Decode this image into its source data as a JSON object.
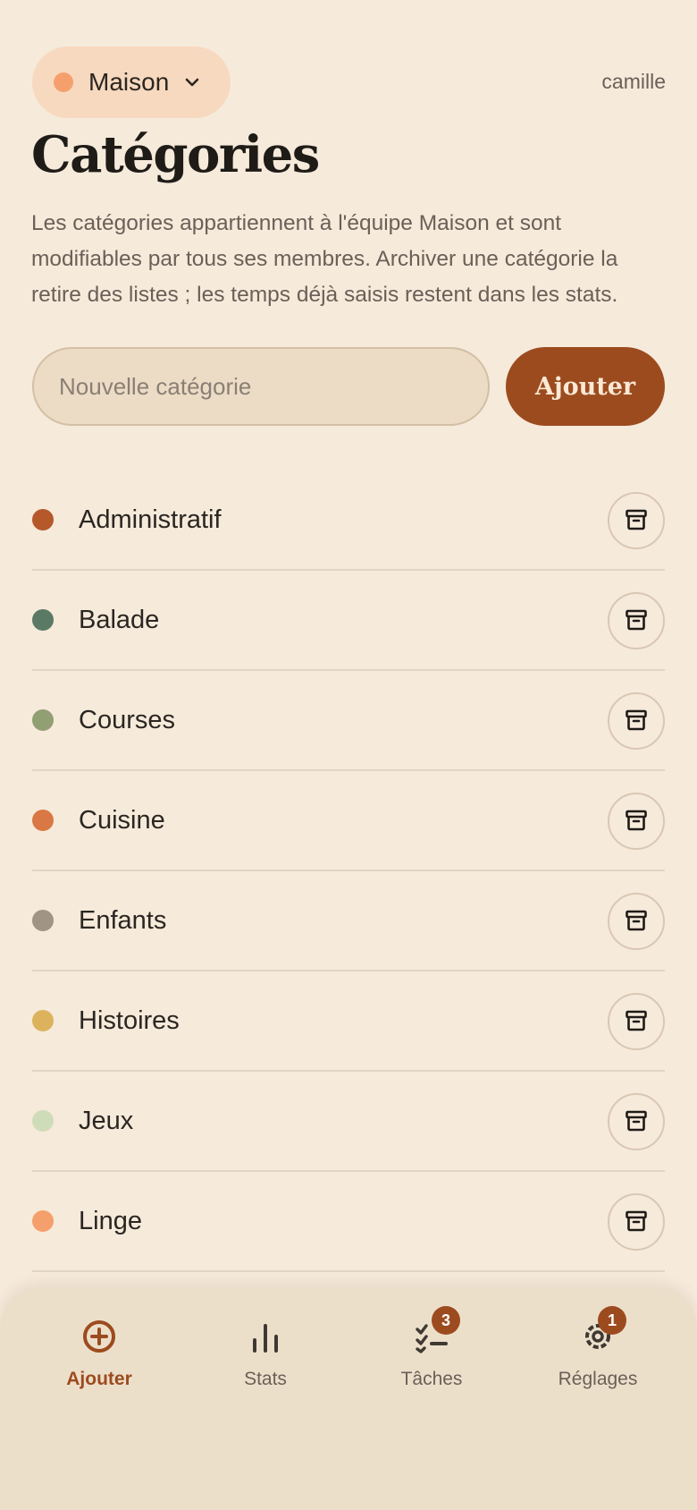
{
  "header": {
    "team_name": "Maison",
    "team_color": "#f5a06c",
    "username": "camille"
  },
  "title": "Catégories",
  "description": "Les catégories appartiennent à l'équipe Maison et sont modifiables par tous ses membres. Archiver une catégorie la retire des listes ; les temps déjà saisis restent dans les stats.",
  "new_category": {
    "placeholder": "Nouvelle catégorie",
    "value": "",
    "button_label": "Ajouter"
  },
  "categories": [
    {
      "label": "Administratif",
      "color": "#b5582a"
    },
    {
      "label": "Balade",
      "color": "#5b7a65"
    },
    {
      "label": "Courses",
      "color": "#919f73"
    },
    {
      "label": "Cuisine",
      "color": "#d97845"
    },
    {
      "label": "Enfants",
      "color": "#a09584"
    },
    {
      "label": "Histoires",
      "color": "#dcb35c"
    },
    {
      "label": "Jeux",
      "color": "#cfdcb9"
    },
    {
      "label": "Linge",
      "color": "#f5a06c"
    }
  ],
  "archive_icon": "archive-box-icon",
  "tabs": [
    {
      "label": "Ajouter",
      "icon": "plus-circle-icon",
      "active": true
    },
    {
      "label": "Stats",
      "icon": "bar-chart-icon",
      "active": false
    },
    {
      "label": "Tâches",
      "icon": "checklist-icon",
      "active": false,
      "badge": "3"
    },
    {
      "label": "Réglages",
      "icon": "gear-icon",
      "active": false,
      "badge": "1"
    }
  ],
  "colors": {
    "background": "#f6eadb",
    "accent": "#9c4b1f"
  }
}
